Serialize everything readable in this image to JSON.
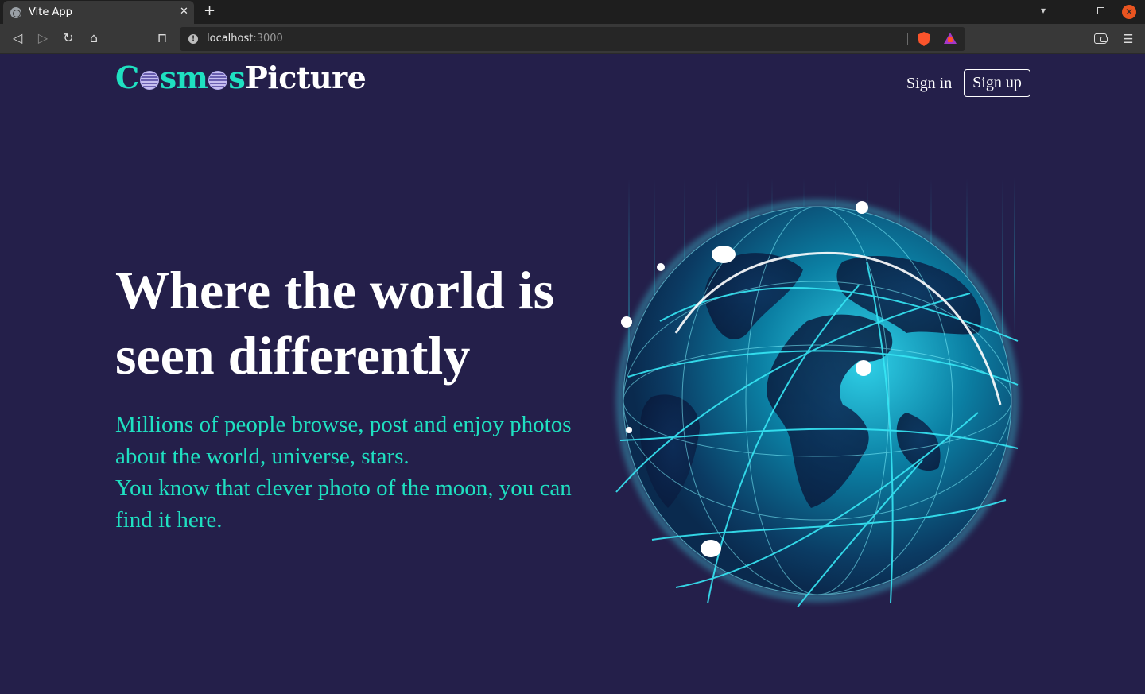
{
  "browser": {
    "tab_title": "Vite App",
    "url_host": "localhost",
    "url_port": ":3000",
    "icons": [
      "globe-icon",
      "close-icon",
      "plus-icon",
      "chevron-down-icon",
      "minimize-icon",
      "restore-icon",
      "close-window-icon",
      "back-icon",
      "forward-icon",
      "reload-icon",
      "home-icon",
      "bookmark-icon",
      "info-icon",
      "brave-shield-icon",
      "brave-rewards-icon",
      "wallet-icon",
      "menu-icon"
    ]
  },
  "header": {
    "logo_c": "C",
    "logo_sm": "sm",
    "logo_s": "s",
    "logo_picture": "Picture",
    "sign_in": "Sign in",
    "sign_up": "Sign up"
  },
  "hero": {
    "headline": "Where the world is seen differently",
    "subtext_line1": "Millions of people browse, post and enjoy photos about the world, universe, stars.",
    "subtext_line2": "You know that clever photo of the moon, you can find it here."
  },
  "colors": {
    "background": "#241f4a",
    "accent": "#1fe0c1",
    "text": "#ffffff"
  }
}
